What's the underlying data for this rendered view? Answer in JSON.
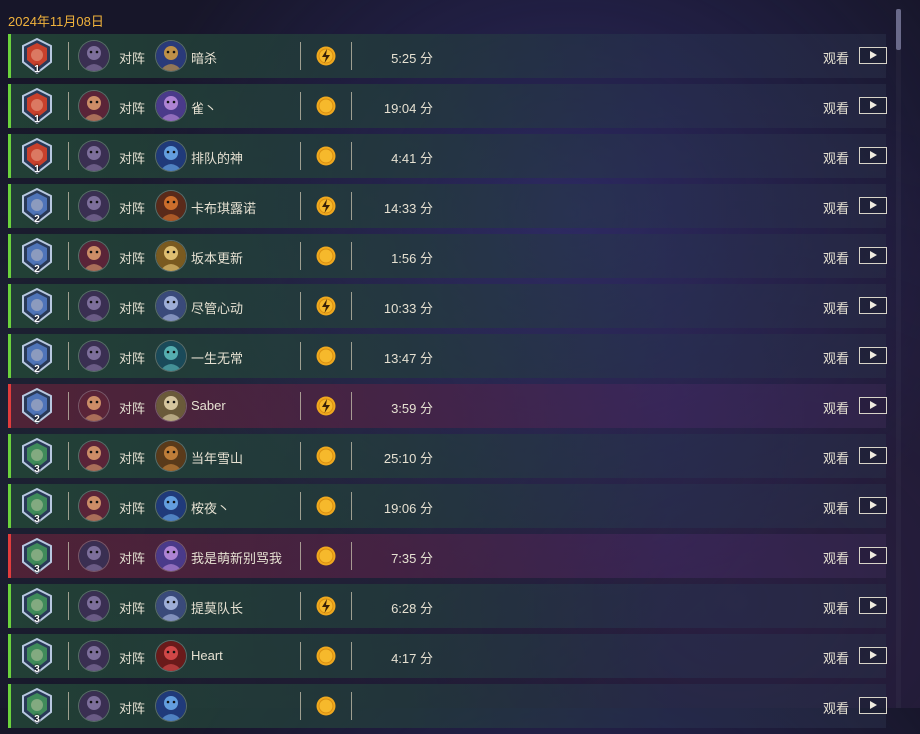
{
  "date": "2024年11月08日",
  "vs_label": "对阵",
  "watch_label": "观看",
  "colors": {
    "win": "#6bd23d",
    "loss": "#e23c3c",
    "date": "#f0b23c",
    "coin": "#f0a91e"
  },
  "matches": [
    {
      "rank": "1",
      "rank_color": "#c8402c",
      "hero": "warlock",
      "opponent": "暗杀",
      "opp_hero": "mage",
      "coin": "second",
      "duration": "5:25 分",
      "result": "win"
    },
    {
      "rank": "1",
      "rank_color": "#c8402c",
      "hero": "demonhunter",
      "opponent": "雀丶",
      "opp_hero": "shaman",
      "coin": "first",
      "duration": "19:04 分",
      "result": "win"
    },
    {
      "rank": "1",
      "rank_color": "#c8402c",
      "hero": "warlock",
      "opponent": "排队的神",
      "opp_hero": "frost",
      "coin": "first",
      "duration": "4:41 分",
      "result": "win"
    },
    {
      "rank": "2",
      "rank_color": "#4f74b8",
      "hero": "warlock",
      "opponent": "卡布琪露诺",
      "opp_hero": "hunter",
      "coin": "second",
      "duration": "14:33 分",
      "result": "win"
    },
    {
      "rank": "2",
      "rank_color": "#4f74b8",
      "hero": "demonhunter",
      "opponent": "坂本更新",
      "opp_hero": "paladin",
      "coin": "first",
      "duration": "1:56 分",
      "result": "win"
    },
    {
      "rank": "2",
      "rank_color": "#4f74b8",
      "hero": "warlock",
      "opponent": "尽管心动",
      "opp_hero": "priest",
      "coin": "second",
      "duration": "10:33 分",
      "result": "win"
    },
    {
      "rank": "2",
      "rank_color": "#4f74b8",
      "hero": "warlock",
      "opponent": "一生无常",
      "opp_hero": "rogue",
      "coin": "first",
      "duration": "13:47 分",
      "result": "win"
    },
    {
      "rank": "2",
      "rank_color": "#4f74b8",
      "hero": "demonhunter",
      "opponent": "Saber",
      "opp_hero": "druid",
      "coin": "second",
      "duration": "3:59 分",
      "result": "loss"
    },
    {
      "rank": "3",
      "rank_color": "#3f8a5a",
      "hero": "demonhunter",
      "opponent": "当年雪山",
      "opp_hero": "warrior",
      "coin": "first",
      "duration": "25:10 分",
      "result": "win"
    },
    {
      "rank": "3",
      "rank_color": "#3f8a5a",
      "hero": "demonhunter",
      "opponent": "桉夜丶",
      "opp_hero": "frost",
      "coin": "first",
      "duration": "19:06 分",
      "result": "win"
    },
    {
      "rank": "3",
      "rank_color": "#3f8a5a",
      "hero": "warlock",
      "opponent": "我是萌新别骂我",
      "opp_hero": "shaman",
      "coin": "first",
      "duration": "7:35 分",
      "result": "loss"
    },
    {
      "rank": "3",
      "rank_color": "#3f8a5a",
      "hero": "warlock",
      "opponent": "提莫队长",
      "opp_hero": "priest",
      "coin": "second",
      "duration": "6:28 分",
      "result": "win"
    },
    {
      "rank": "3",
      "rank_color": "#3f8a5a",
      "hero": "warlock",
      "opponent": "Heart",
      "opp_hero": "deathknight",
      "coin": "first",
      "duration": "4:17 分",
      "result": "win"
    },
    {
      "rank": "3",
      "rank_color": "#3f8a5a",
      "hero": "warlock",
      "opponent": "",
      "opp_hero": "frost",
      "coin": "first",
      "duration": "",
      "result": "win"
    }
  ]
}
